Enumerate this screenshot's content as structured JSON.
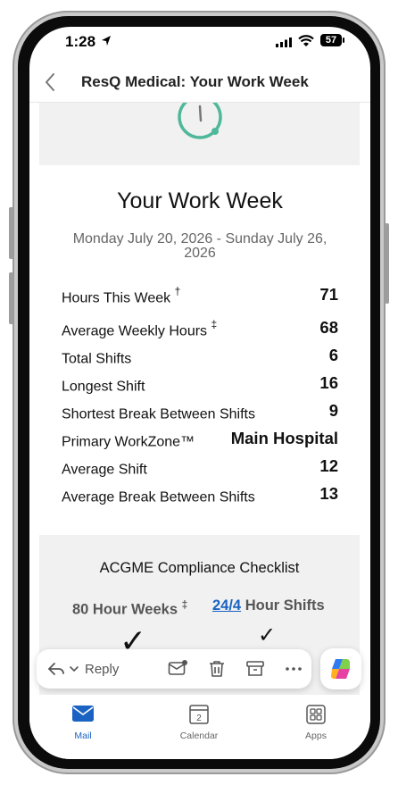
{
  "status_bar": {
    "time": "1:28",
    "battery": "57"
  },
  "nav": {
    "title": "ResQ Medical: Your Work Week"
  },
  "email": {
    "heading": "Your Work Week",
    "date_range": "Monday July 20, 2026 - Sunday July 26, 2026",
    "stats": [
      {
        "label": "Hours This Week",
        "mark": "†",
        "value": "71"
      },
      {
        "label": "Average Weekly Hours",
        "mark": "‡",
        "value": "68"
      },
      {
        "label": "Total Shifts",
        "mark": "",
        "value": "6"
      },
      {
        "label": "Longest Shift",
        "mark": "",
        "value": "16"
      },
      {
        "label": "Shortest Break Between Shifts",
        "mark": "",
        "value": "9"
      },
      {
        "label": "Primary WorkZone™",
        "mark": "",
        "value": "Main Hospital"
      },
      {
        "label": "Average Shift",
        "mark": "",
        "value": "12"
      },
      {
        "label": "Average Break Between Shifts",
        "mark": "",
        "value": "13"
      }
    ],
    "compliance": {
      "title": "ACGME Compliance Checklist",
      "left_item": "80 Hour Weeks",
      "left_mark": "‡",
      "right_link": "24/4",
      "right_rest": " Hour Shifts",
      "check": "✓"
    }
  },
  "toolbar": {
    "reply_label": "Reply",
    "icons": [
      "reply-arrow-icon",
      "chevron-down-icon",
      "mail-unread-icon",
      "trash-icon",
      "archive-icon",
      "more-icon",
      "copilot-icon"
    ]
  },
  "tabs": [
    {
      "label": "Mail",
      "active": true
    },
    {
      "label": "Calendar",
      "active": false,
      "icon_text": "2"
    },
    {
      "label": "Apps",
      "active": false
    }
  ],
  "colors": {
    "accent": "#1a63c2",
    "gauge": "#4fb89a",
    "panel": "#f1f1f1"
  }
}
